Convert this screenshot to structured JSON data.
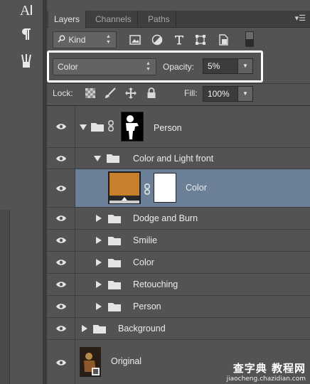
{
  "tabs": [
    "Layers",
    "Channels",
    "Paths"
  ],
  "filter": {
    "kind_label": "Kind"
  },
  "blend": {
    "mode": "Color",
    "opacity_label": "Opacity:",
    "opacity_value": "5%"
  },
  "lock": {
    "label": "Lock:",
    "fill_label": "Fill:",
    "fill_value": "100%"
  },
  "layers": [
    {
      "name": "Person"
    },
    {
      "name": "Color and Light front"
    },
    {
      "name": "Color"
    },
    {
      "name": "Dodge and Burn"
    },
    {
      "name": "Smilie"
    },
    {
      "name": "Color"
    },
    {
      "name": "Retouching"
    },
    {
      "name": "Person"
    },
    {
      "name": "Background"
    },
    {
      "name": "Original"
    }
  ],
  "watermark": {
    "top": "查字典 教程网",
    "bottom": "jiaocheng.chazidian.com"
  },
  "colors": {
    "fill_swatch": "#c9802c",
    "selected_row": "#6b7f97",
    "panel": "#535353"
  }
}
